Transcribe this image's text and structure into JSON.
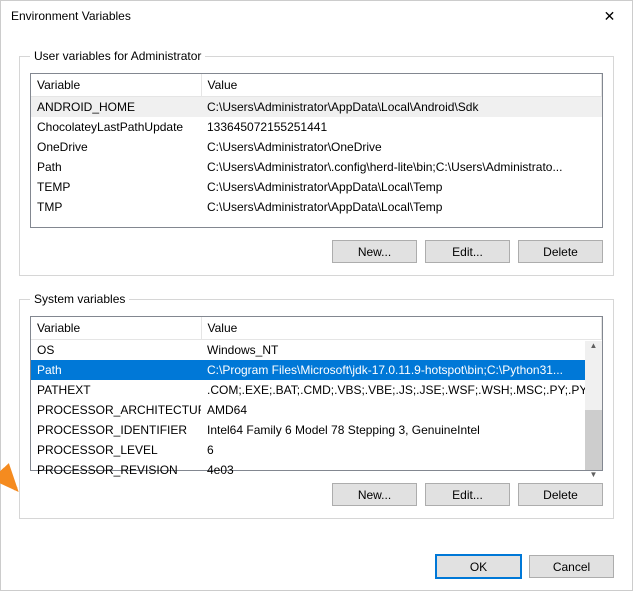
{
  "window": {
    "title": "Environment Variables",
    "close_glyph": "✕"
  },
  "user_section": {
    "legend": "User variables for Administrator",
    "col_variable": "Variable",
    "col_value": "Value",
    "rows": [
      {
        "variable": "ANDROID_HOME",
        "value": "C:\\Users\\Administrator\\AppData\\Local\\Android\\Sdk",
        "selected": true
      },
      {
        "variable": "ChocolateyLastPathUpdate",
        "value": "133645072155251441",
        "selected": false
      },
      {
        "variable": "OneDrive",
        "value": "C:\\Users\\Administrator\\OneDrive",
        "selected": false
      },
      {
        "variable": "Path",
        "value": "C:\\Users\\Administrator\\.config\\herd-lite\\bin;C:\\Users\\Administrato...",
        "selected": false
      },
      {
        "variable": "TEMP",
        "value": "C:\\Users\\Administrator\\AppData\\Local\\Temp",
        "selected": false
      },
      {
        "variable": "TMP",
        "value": "C:\\Users\\Administrator\\AppData\\Local\\Temp",
        "selected": false
      }
    ],
    "btn_new": "New...",
    "btn_edit": "Edit...",
    "btn_delete": "Delete"
  },
  "system_section": {
    "legend": "System variables",
    "col_variable": "Variable",
    "col_value": "Value",
    "rows": [
      {
        "variable": "OS",
        "value": "Windows_NT",
        "selected": false
      },
      {
        "variable": "Path",
        "value": "C:\\Program Files\\Microsoft\\jdk-17.0.11.9-hotspot\\bin;C:\\Python31...",
        "selected": true
      },
      {
        "variable": "PATHEXT",
        "value": ".COM;.EXE;.BAT;.CMD;.VBS;.VBE;.JS;.JSE;.WSF;.WSH;.MSC;.PY;.PYW",
        "selected": false
      },
      {
        "variable": "PROCESSOR_ARCHITECTURE",
        "value": "AMD64",
        "selected": false
      },
      {
        "variable": "PROCESSOR_IDENTIFIER",
        "value": "Intel64 Family 6 Model 78 Stepping 3, GenuineIntel",
        "selected": false
      },
      {
        "variable": "PROCESSOR_LEVEL",
        "value": "6",
        "selected": false
      },
      {
        "variable": "PROCESSOR_REVISION",
        "value": "4e03",
        "selected": false
      }
    ],
    "btn_new": "New...",
    "btn_edit": "Edit...",
    "btn_delete": "Delete"
  },
  "footer": {
    "ok": "OK",
    "cancel": "Cancel"
  },
  "annotation": {
    "arrow_color": "#f58b1f"
  }
}
